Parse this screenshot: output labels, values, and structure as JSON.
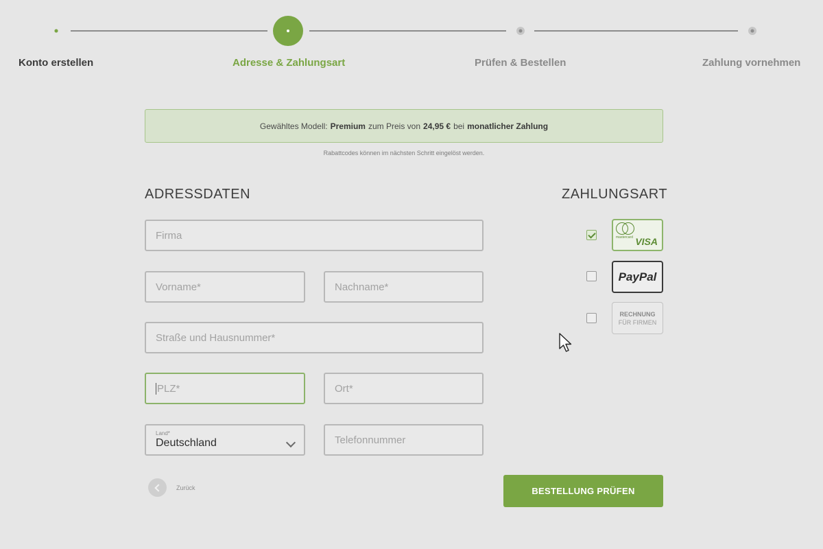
{
  "colors": {
    "accent": "#7aa644",
    "banner_bg": "#d8e3cd"
  },
  "stepper": {
    "steps": [
      {
        "label": "Konto erstellen",
        "state": "done"
      },
      {
        "label": "Adresse & Zahlungsart",
        "state": "active"
      },
      {
        "label": "Prüfen & Bestellen",
        "state": "future"
      },
      {
        "label": "Zahlung vornehmen",
        "state": "future"
      }
    ]
  },
  "banner": {
    "prefix": "Gewähltes Modell:",
    "model": "Premium",
    "mid": "zum Preis von",
    "price": "24,95 €",
    "suffix": "bei",
    "billing": "monatlicher Zahlung"
  },
  "note": "Rabattcodes können im nächsten Schritt eingelöst werden.",
  "address": {
    "title": "ADRESSDATEN",
    "company_placeholder": "Firma",
    "firstname_placeholder": "Vorname*",
    "lastname_placeholder": "Nachname*",
    "street_placeholder": "Straße und Hausnummer*",
    "zip_placeholder": "PLZ*",
    "city_placeholder": "Ort*",
    "country_label": "Land*",
    "country_value": "Deutschland",
    "phone_placeholder": "Telefonnummer"
  },
  "payment": {
    "title": "ZAHLUNGSART",
    "options": [
      {
        "name": "card",
        "checked": true,
        "card_brand_small": "mastercard",
        "card_brand": "VISA"
      },
      {
        "name": "paypal",
        "checked": false,
        "label": "PayPal"
      },
      {
        "name": "invoice",
        "checked": false,
        "line1": "RECHNUNG",
        "line2": "FÜR FIRMEN"
      }
    ]
  },
  "actions": {
    "back_label": "Zurück",
    "submit_label": "BESTELLUNG PRÜFEN"
  }
}
